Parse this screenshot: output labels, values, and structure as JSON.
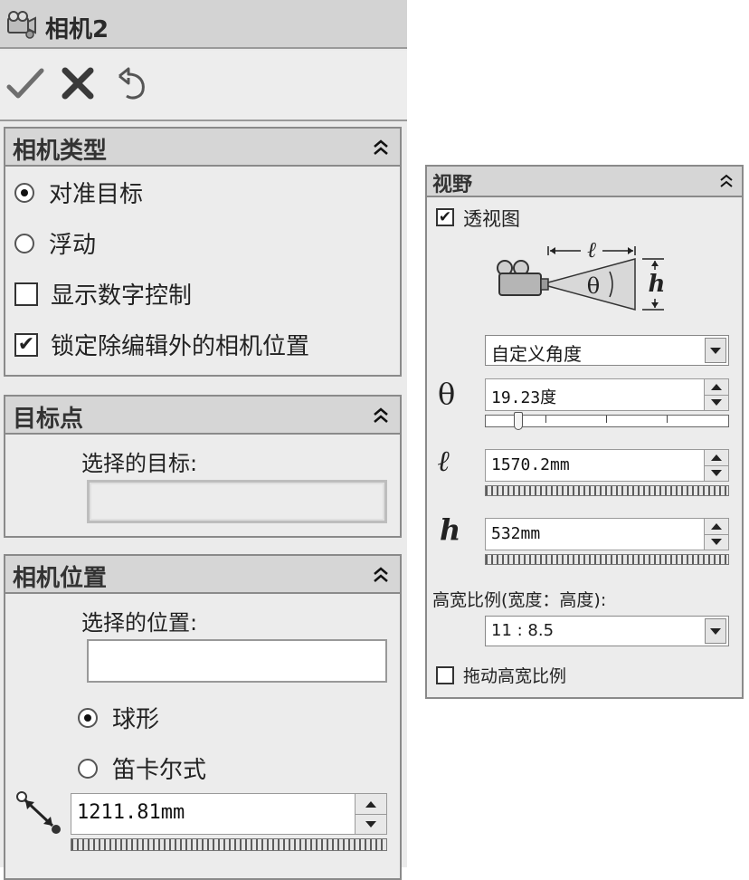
{
  "window": {
    "title": "相机2",
    "icon": "camera-icon"
  },
  "actions": [
    {
      "name": "ok",
      "icon": "checkmark-icon"
    },
    {
      "name": "cancel",
      "icon": "x-icon"
    },
    {
      "name": "undo",
      "icon": "undo-icon"
    }
  ],
  "camera_type": {
    "title": "相机类型",
    "radio_aim": "对准目标",
    "radio_float": "浮动",
    "selected": "对准目标",
    "show_numeric": {
      "label": "显示数字控制",
      "checked": false
    },
    "lock_position": {
      "label": "锁定除编辑外的相机位置",
      "checked": true
    }
  },
  "target_point": {
    "title": "目标点",
    "selected_target_label": "选择的目标:",
    "selected_target_value": ""
  },
  "camera_position": {
    "title": "相机位置",
    "selected_position_label": "选择的位置:",
    "selected_position_value": "",
    "radio_spherical": "球形",
    "radio_cartesian": "笛卡尔式",
    "selected": "球形",
    "distance": "1211.81mm"
  },
  "field_of_view": {
    "title": "视野",
    "perspective": {
      "label": "透视图",
      "checked": true
    },
    "diagram": {
      "length_symbol": "ℓ",
      "height_symbol": "h",
      "angle_symbol": "θ"
    },
    "preset": "自定义角度",
    "theta_symbol": "θ",
    "theta_value": "19.23度",
    "theta_slider_fraction": 0.12,
    "length_symbol": "ℓ",
    "length_value": "1570.2mm",
    "height_symbol": "h",
    "height_value": "532mm",
    "aspect_label": "高宽比例(宽度：高度):",
    "aspect_value": "11 : 8.5",
    "drag_aspect": {
      "label": "拖动高宽比例",
      "checked": false
    }
  }
}
